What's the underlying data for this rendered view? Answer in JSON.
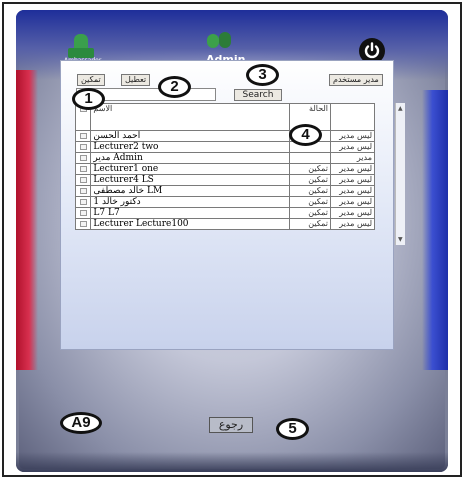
{
  "header": {
    "logo_text": "Ambassador",
    "admin_label": "Admin"
  },
  "toolbar": {
    "enable_label": "تمكين",
    "disable_label": "تعطيل",
    "admin_label": "مدير مستخدم"
  },
  "search": {
    "value": "",
    "button_label": "Search"
  },
  "table": {
    "headers": {
      "name": "الاسم",
      "status": "الحالة",
      "role": ""
    },
    "rows": [
      {
        "name": "أحمد الحسن",
        "status": "",
        "role": "ليس مدير"
      },
      {
        "name": "Lecturer2 two",
        "status": "",
        "role": "ليس مدير"
      },
      {
        "name": "مدير Admin",
        "status": "",
        "role": "مدير"
      },
      {
        "name": "Lecturer1 one",
        "status": "تمكين",
        "role": "ليس مدير"
      },
      {
        "name": "Lecturer4 LS",
        "status": "تمكين",
        "role": "ليس مدير"
      },
      {
        "name": "خالد مصطفى LM",
        "status": "تمكين",
        "role": "ليس مدير"
      },
      {
        "name": "1 دكتور خالد",
        "status": "تمكين",
        "role": "ليس مدير"
      },
      {
        "name": "L7 L7",
        "status": "تمكين",
        "role": "ليس مدير"
      },
      {
        "name": "Lecturer Lecture100",
        "status": "تمكين",
        "role": "ليس مدير"
      }
    ]
  },
  "callouts": {
    "c1": "1",
    "c2": "2",
    "c3": "3",
    "c4": "4",
    "c5": "5",
    "a9": "A9"
  },
  "footer": {
    "back_label": "رجوع"
  },
  "colors": {
    "frame_blue": "#1e2e9a",
    "frame_red": "#b0112c",
    "panel_bg": "#e3e9f7"
  }
}
